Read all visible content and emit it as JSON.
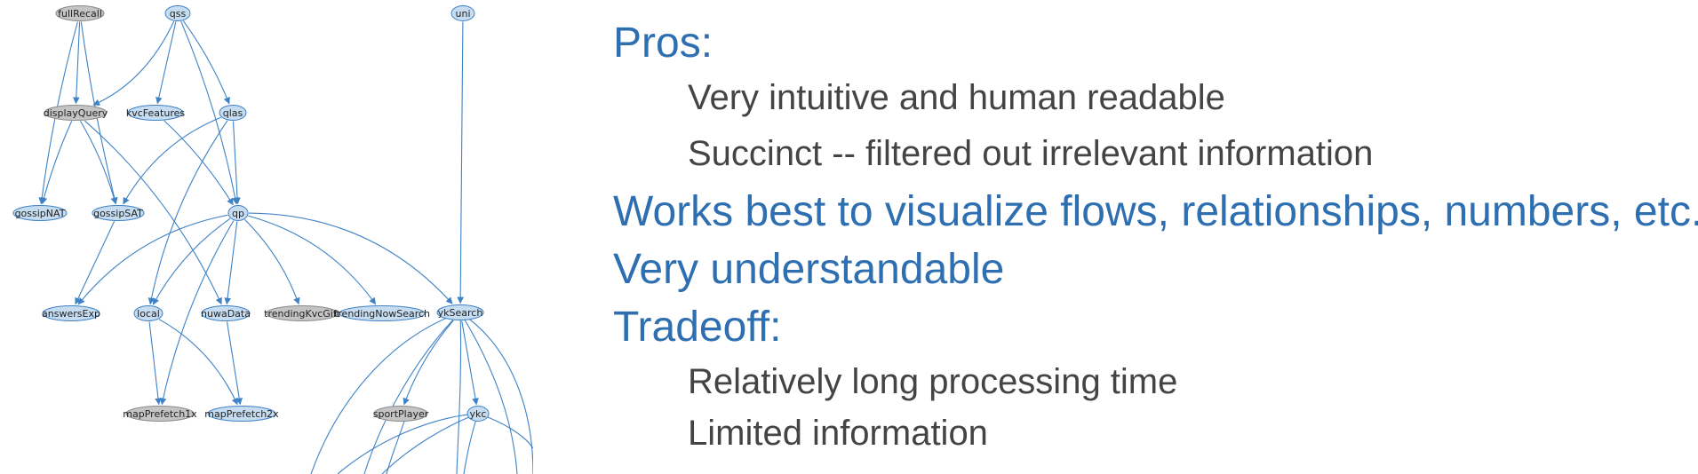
{
  "colors": {
    "heading": "#2e6fb2",
    "body_text": "#444444",
    "edge": "#3f82c6",
    "node_blue_fill": "#c6dcf0",
    "node_blue_stroke": "#3f82c6",
    "node_gray_fill": "#c4c4c4",
    "node_gray_stroke": "#8a8a8a"
  },
  "graph": {
    "nodes": [
      {
        "id": "fullRecall",
        "label": "fullRecall",
        "style": "gray"
      },
      {
        "id": "qss",
        "label": "qss",
        "style": "blue"
      },
      {
        "id": "uni",
        "label": "uni",
        "style": "blue"
      },
      {
        "id": "displayQuery",
        "label": "displayQuery",
        "style": "gray"
      },
      {
        "id": "kvcFeatures",
        "label": "kvcFeatures",
        "style": "blue"
      },
      {
        "id": "qlas",
        "label": "qlas",
        "style": "blue"
      },
      {
        "id": "gossipNAT",
        "label": "gossipNAT",
        "style": "blue"
      },
      {
        "id": "gossipSAT",
        "label": "gossipSAT",
        "style": "blue"
      },
      {
        "id": "qp",
        "label": "qp",
        "style": "blue"
      },
      {
        "id": "answersExp",
        "label": "answersExp",
        "style": "blue"
      },
      {
        "id": "local",
        "label": "local",
        "style": "blue"
      },
      {
        "id": "nuwaData",
        "label": "nuwaData",
        "style": "blue"
      },
      {
        "id": "trendingKvcGift",
        "label": "trendingKvcGift",
        "style": "gray"
      },
      {
        "id": "trendingNowSearch",
        "label": "trendingNowSearch",
        "style": "blue"
      },
      {
        "id": "ykSearch",
        "label": "ykSearch",
        "style": "blue"
      },
      {
        "id": "mapPrefetch1x",
        "label": "mapPrefetch1x",
        "style": "gray"
      },
      {
        "id": "mapPrefetch2x",
        "label": "mapPrefetch2x",
        "style": "blue"
      },
      {
        "id": "sportPlayer",
        "label": "sportPlayer",
        "style": "gray"
      },
      {
        "id": "ykc",
        "label": "ykc",
        "style": "blue"
      }
    ],
    "edges": [
      [
        "fullRecall",
        "displayQuery"
      ],
      [
        "fullRecall",
        "gossipNAT"
      ],
      [
        "fullRecall",
        "gossipSAT"
      ],
      [
        "qss",
        "displayQuery"
      ],
      [
        "qss",
        "kvcFeatures"
      ],
      [
        "qss",
        "qlas"
      ],
      [
        "qss",
        "qp"
      ],
      [
        "uni",
        "ykSearch"
      ],
      [
        "displayQuery",
        "gossipNAT"
      ],
      [
        "displayQuery",
        "gossipSAT"
      ],
      [
        "displayQuery",
        "nuwaData"
      ],
      [
        "kvcFeatures",
        "qp"
      ],
      [
        "qlas",
        "qp"
      ],
      [
        "qlas",
        "gossipSAT"
      ],
      [
        "qlas",
        "local"
      ],
      [
        "gossipSAT",
        "answersExp"
      ],
      [
        "qp",
        "answersExp"
      ],
      [
        "qp",
        "local"
      ],
      [
        "qp",
        "nuwaData"
      ],
      [
        "qp",
        "trendingKvcGift"
      ],
      [
        "qp",
        "trendingNowSearch"
      ],
      [
        "qp",
        "ykSearch"
      ],
      [
        "qp",
        "mapPrefetch1x"
      ],
      [
        "local",
        "mapPrefetch1x"
      ],
      [
        "local",
        "mapPrefetch2x"
      ],
      [
        "nuwaData",
        "mapPrefetch2x"
      ],
      [
        "ykSearch",
        "sportPlayer"
      ],
      [
        "ykSearch",
        "ykc"
      ]
    ]
  },
  "bullets": [
    {
      "text": "Pros:",
      "level": 0
    },
    {
      "text": "Very intuitive and human readable",
      "level": 1
    },
    {
      "text": "Succinct -- filtered out irrelevant information",
      "level": 1
    },
    {
      "text": "Works best to visualize flows, relationships, numbers, etc.",
      "level": 0
    },
    {
      "text": "Very understandable",
      "level": 0
    },
    {
      "text": "Tradeoff:",
      "level": 0
    },
    {
      "text": "Relatively long processing time",
      "level": 1
    },
    {
      "text": "Limited information",
      "level": 1
    }
  ]
}
